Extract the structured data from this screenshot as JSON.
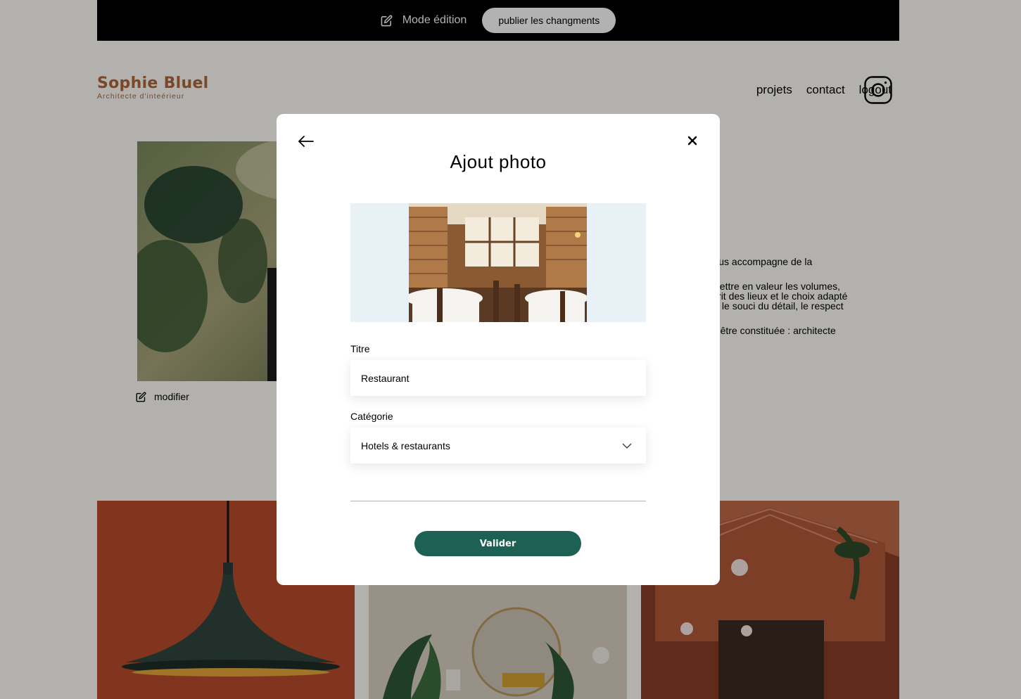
{
  "edit_bar": {
    "mode_label": "Mode édition",
    "publish_label": "publier les changments"
  },
  "header": {
    "logo_title": "Sophie Bluel",
    "logo_subtitle": "Architecte d'inteérieur",
    "nav": [
      "projets",
      "contact",
      "logout"
    ],
    "instagram_icon": "instagram-icon"
  },
  "intro": {
    "modify_label": "modifier",
    "paragraphs": [
      ". Je vous accompagne de la",
      "on à mettre en valeur les volumes,\ne l'esprit des lieux et le choix adapté\né dans le souci du détail, le respect",
      "e peut-être constituée : architecte"
    ]
  },
  "modal": {
    "title": "Ajout photo",
    "back_icon": "arrow-left-icon",
    "close_icon": "close-icon",
    "title_label": "Titre",
    "title_value": "Restaurant",
    "category_label": "Catégorie",
    "category_value": "Hotels & restaurants",
    "submit_label": "Valider"
  },
  "colors": {
    "brand": "#B1663C",
    "button": "#1D6154",
    "upload_bg": "#E8F1F6",
    "bar": "#000000"
  }
}
